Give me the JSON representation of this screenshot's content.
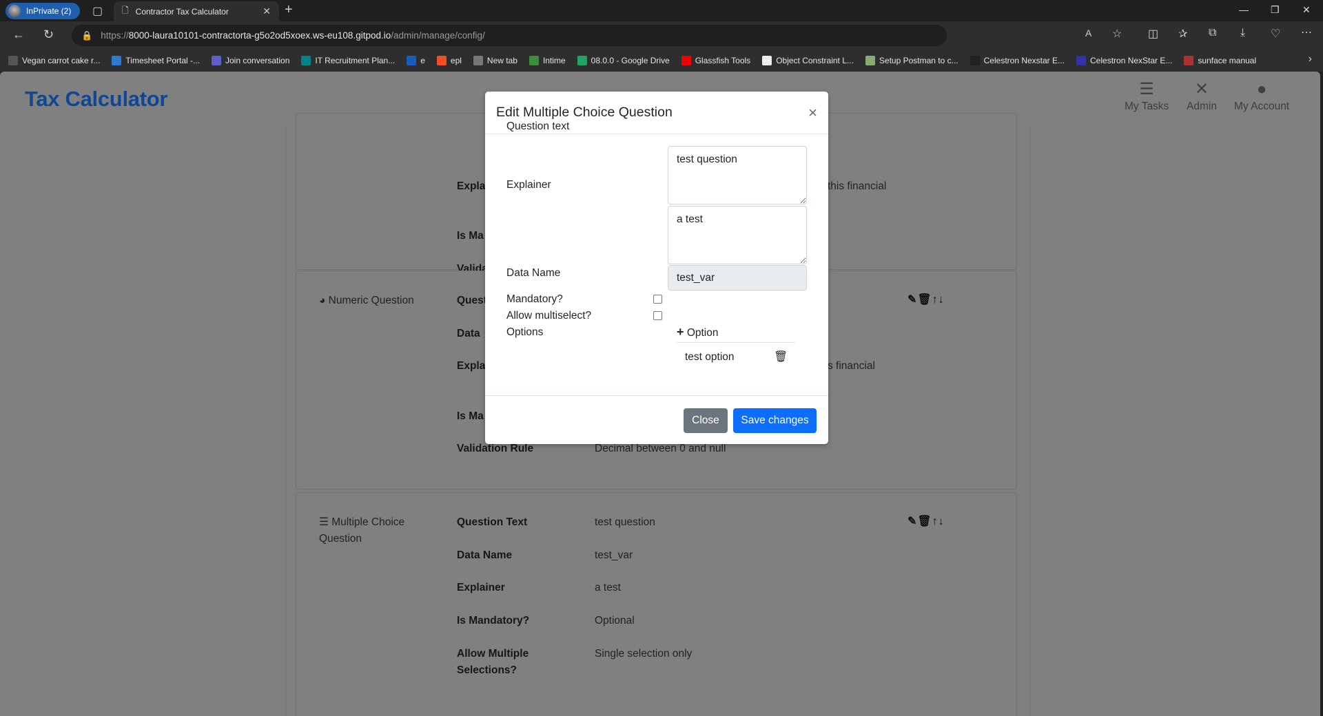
{
  "browser": {
    "profile_label": "InPrivate (2)",
    "tab_title": "Contractor Tax Calculator",
    "url_prefix": "https://",
    "url_host": "8000-laura10101-contractorta-g5o2od5xoex.ws-eu108.gitpod.io",
    "url_path": "/admin/manage/config/",
    "bookmarks": [
      {
        "label": "Vegan carrot cake r...",
        "color": "#555"
      },
      {
        "label": "Timesheet Portal -...",
        "color": "#2a7bd1"
      },
      {
        "label": "Join conversation",
        "color": "#5b5fc7"
      },
      {
        "label": "IT Recruitment Plan...",
        "color": "#038387"
      },
      {
        "label": "e",
        "color": "#185abd"
      },
      {
        "label": "epl",
        "color": "#f25022"
      },
      {
        "label": "New tab",
        "color": "#777"
      },
      {
        "label": "Intime",
        "color": "#3a8f3a"
      },
      {
        "label": "08.0.0 - Google Drive",
        "color": "#1fa463"
      },
      {
        "label": "Glassfish Tools",
        "color": "#e00"
      },
      {
        "label": "Object Constraint L...",
        "color": "#eee"
      },
      {
        "label": "Setup Postman to c...",
        "color": "#8a7"
      },
      {
        "label": "Celestron Nexstar E...",
        "color": "#222"
      },
      {
        "label": "Celestron NexStar E...",
        "color": "#33a"
      },
      {
        "label": "sunface manual",
        "color": "#a33"
      }
    ]
  },
  "header": {
    "brand": "Tax Calculator",
    "nav": [
      {
        "label": "My Tasks",
        "icon": "tasks-icon"
      },
      {
        "label": "Admin",
        "icon": "tools-icon"
      },
      {
        "label": "My Account",
        "icon": "user-icon"
      }
    ]
  },
  "cards": [
    {
      "rows": [
        {
          "label": "Expla",
          "value": "this financial"
        },
        {
          "label": "Is Ma"
        },
        {
          "label": "Valida"
        }
      ]
    },
    {
      "type": "Numeric Question",
      "rows": [
        {
          "label": "Quest"
        },
        {
          "label": "Data"
        },
        {
          "label": "Expla",
          "value": "s financial"
        },
        {
          "label": "Is Ma"
        },
        {
          "label": "Validation Rule",
          "value": "Decimal between 0 and null"
        }
      ]
    },
    {
      "type": "Multiple Choice Question",
      "rows": [
        {
          "label": "Question Text",
          "value": "test question"
        },
        {
          "label": "Data Name",
          "value": "test_var"
        },
        {
          "label": "Explainer",
          "value": "a test"
        },
        {
          "label": "Is Mandatory?",
          "value": "Optional"
        },
        {
          "label": "Allow Multiple Selections?",
          "value": "Single selection only"
        }
      ]
    }
  ],
  "modal": {
    "title": "Edit Multiple Choice Question",
    "close_glyph": "×",
    "question_label": "Question text",
    "question_value": "test question",
    "explainer_label": "Explainer",
    "explainer_value": "a test",
    "dataname_label": "Data Name",
    "dataname_value": "test_var",
    "mandatory_label": "Mandatory?",
    "mandatory_checked": false,
    "multiselect_label": "Allow multiselect?",
    "multiselect_checked": false,
    "options_label": "Options",
    "add_option_label": "Option",
    "options": [
      "test option"
    ],
    "close_button": "Close",
    "save_button": "Save changes",
    "colors": {
      "primary": "#0d6efd",
      "secondary": "#6c757d"
    }
  }
}
